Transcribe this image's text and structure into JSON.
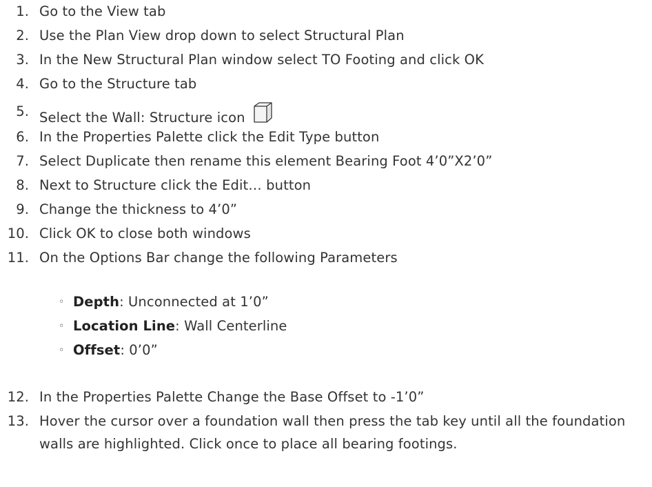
{
  "steps": [
    {
      "number": "1.",
      "text": "Go to the View tab"
    },
    {
      "number": "2.",
      "text": "Use the Plan View drop down to select Structural Plan"
    },
    {
      "number": "3.",
      "text": "In the New Structural Plan window select TO Footing and click OK"
    },
    {
      "number": "4.",
      "text": "Go to the Structure tab"
    },
    {
      "number": "5.",
      "text": "Select the Wall: Structure icon",
      "icon": "wall-structure-icon"
    },
    {
      "number": "6.",
      "text": "In the Properties Palette click the Edit Type button"
    },
    {
      "number": "7.",
      "text": "Select Duplicate then rename this element Bearing Foot 4’0”X2’0”"
    },
    {
      "number": "8.",
      "text": "Next to Structure click the Edit… button"
    },
    {
      "number": "9.",
      "text": "Change the thickness to 4’0”"
    },
    {
      "number": "10.",
      "text": "Click OK to close both windows"
    },
    {
      "number": "11.",
      "text": "On the Options Bar change the following Parameters"
    },
    {
      "number": "12.",
      "text": "In the Properties Palette Change the Base Offset to -1’0”"
    },
    {
      "number": "13.",
      "text": "Hover the cursor over a foundation wall then press the tab key until all the foundation walls are highlighted. Click once to place all bearing footings."
    }
  ],
  "parameters": [
    {
      "bullet": "◦",
      "name": "Depth",
      "value": ": Unconnected at 1’0”"
    },
    {
      "bullet": "◦",
      "name": "Location Line",
      "value": ": Wall Centerline"
    },
    {
      "bullet": "◦",
      "name": "Offset",
      "value": ": 0’0”"
    }
  ]
}
